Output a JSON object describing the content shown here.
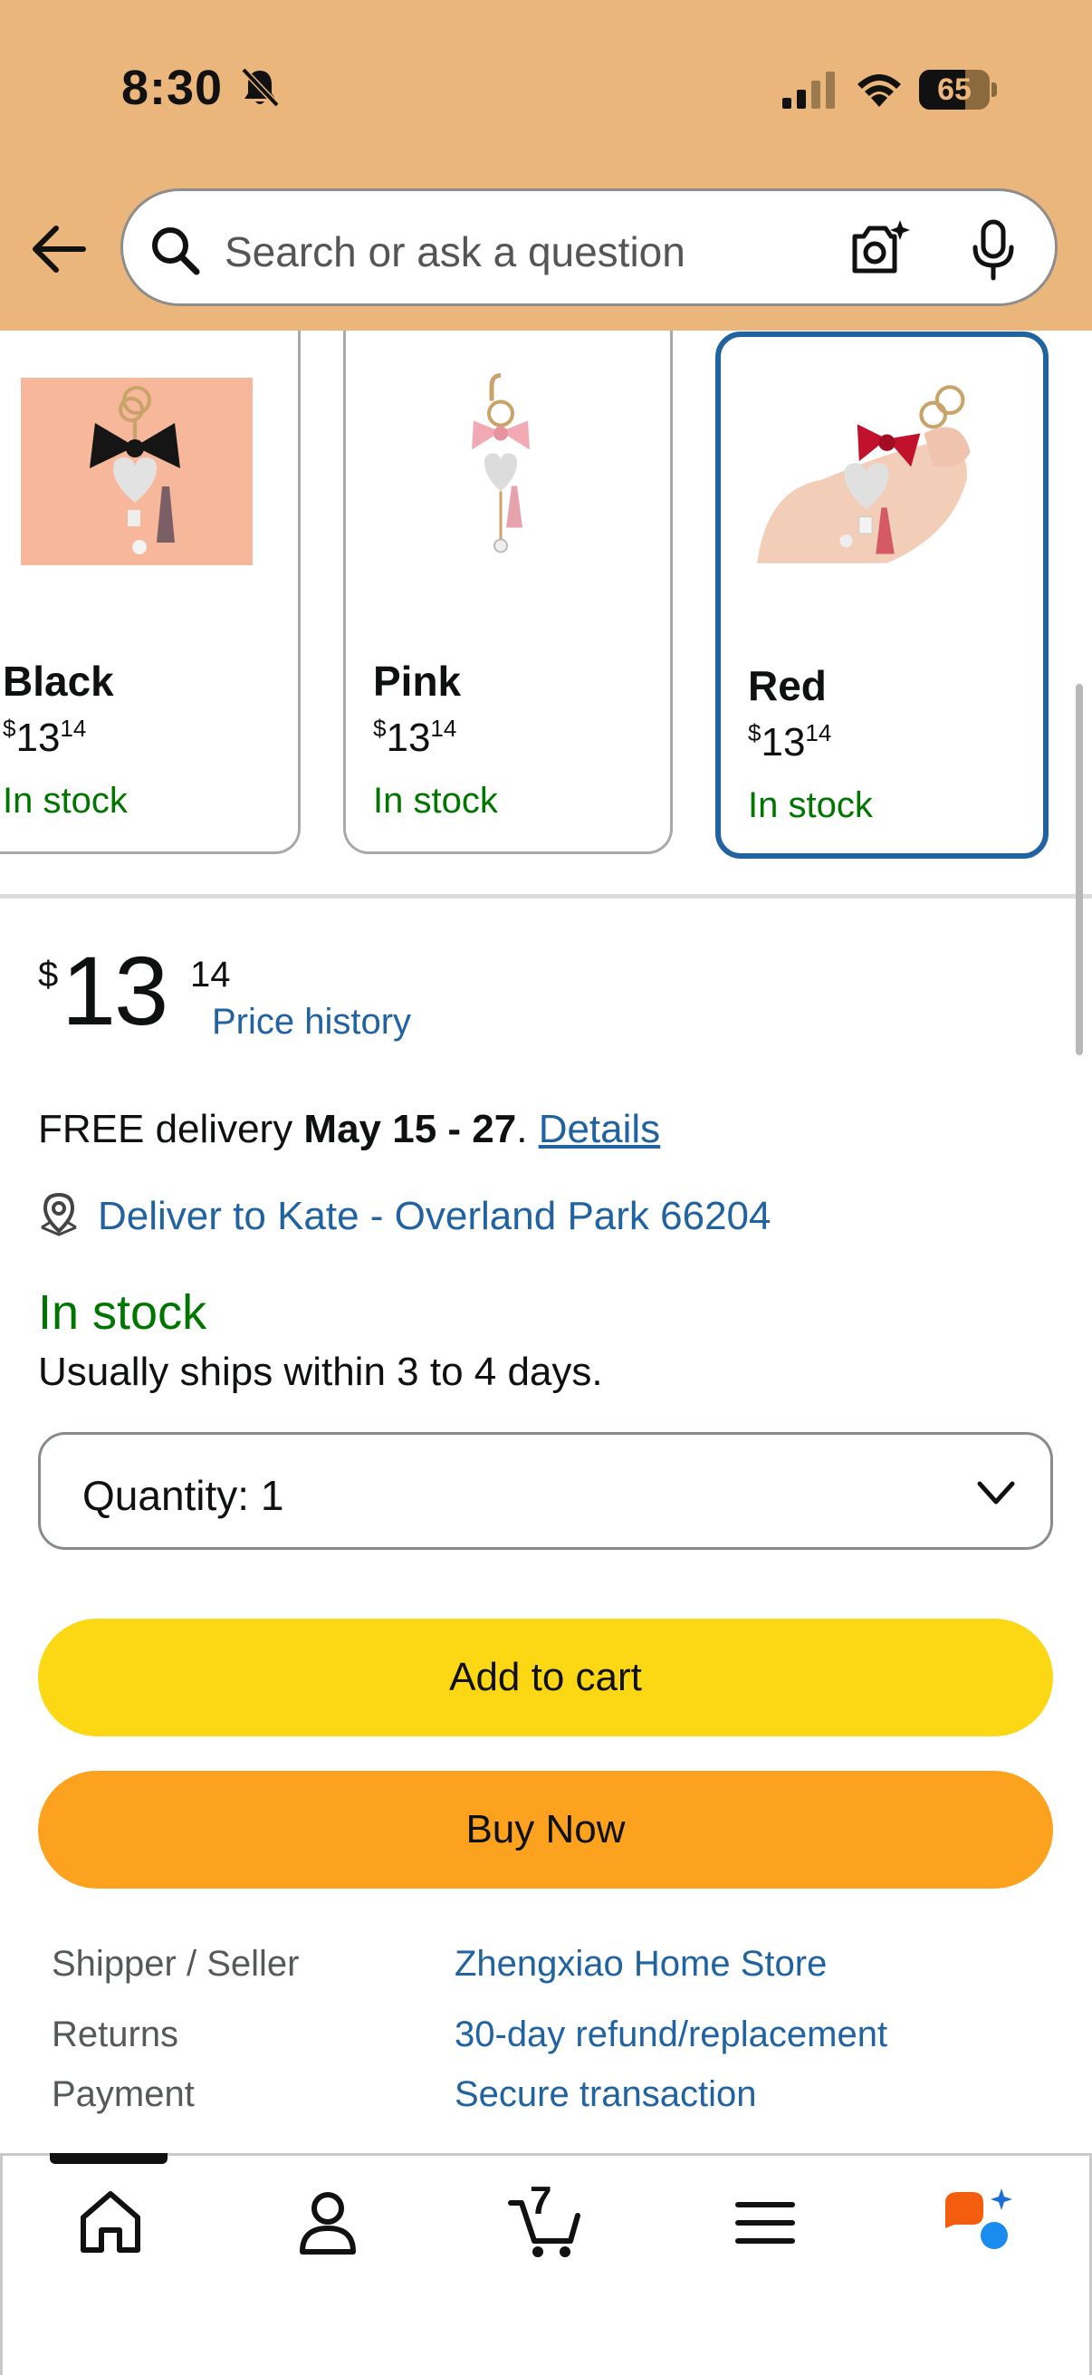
{
  "status_bar": {
    "time": "8:30",
    "battery": "65",
    "battery_level": 0.65
  },
  "search": {
    "placeholder": "Search or ask a question"
  },
  "variants": [
    {
      "name": "Black",
      "price_whole": "13",
      "price_frac": "14",
      "currency": "$",
      "stock": "In stock",
      "selected": false
    },
    {
      "name": "Pink",
      "price_whole": "13",
      "price_frac": "14",
      "currency": "$",
      "stock": "In stock",
      "selected": false
    },
    {
      "name": "Red",
      "price_whole": "13",
      "price_frac": "14",
      "currency": "$",
      "stock": "In stock",
      "selected": true
    }
  ],
  "price": {
    "currency": "$",
    "whole": "13",
    "fraction": "14",
    "history_link": "Price history"
  },
  "delivery": {
    "prefix": "FREE delivery ",
    "dates": "May 15 - 27",
    "period": ". ",
    "details_link": "Details"
  },
  "location": {
    "text": "Deliver to Kate - Overland Park 66204"
  },
  "availability": {
    "status": "In stock",
    "shipping_note": "Usually ships within 3 to 4 days."
  },
  "quantity": {
    "label": "Quantity:",
    "value": "1"
  },
  "actions": {
    "add_to_cart": "Add to cart",
    "buy_now": "Buy Now"
  },
  "info_rows": [
    {
      "label": "Shipper / Seller",
      "value": "Zhengxiao Home Store"
    },
    {
      "label": "Returns",
      "value": "30-day refund/replacement"
    },
    {
      "label": "Payment",
      "value": "Secure transaction"
    }
  ],
  "bottom_nav": {
    "items": [
      "home-icon",
      "account-icon",
      "cart-icon",
      "menu-icon",
      "rufus-ai-icon"
    ],
    "cart_count": "7"
  },
  "colors": {
    "accent_link": "#2162a1",
    "in_stock": "#007600",
    "add_to_cart": "#fcd713",
    "buy_now": "#fca21e",
    "header_bg": "#ebb67c",
    "selected_border": "#2162a1"
  }
}
